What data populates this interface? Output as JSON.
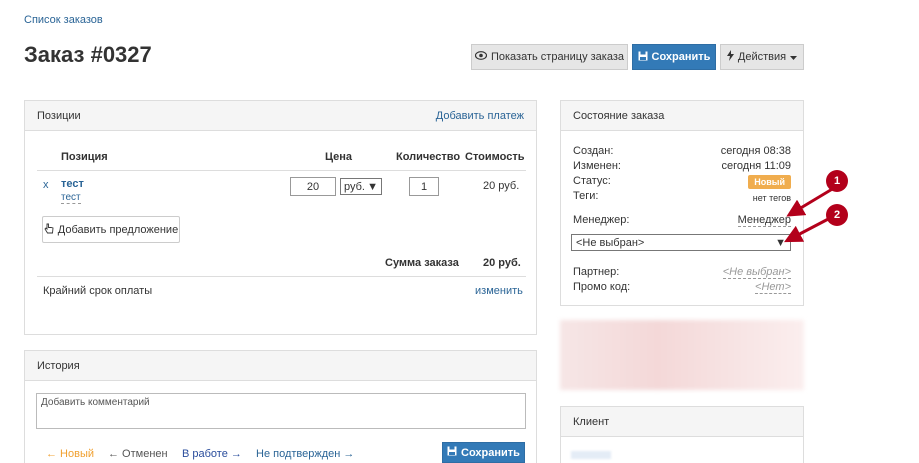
{
  "breadcrumb": {
    "label": "Список заказов"
  },
  "page": {
    "title": "Заказ #0327"
  },
  "toolbar": {
    "show_page_label": "Показать страницу заказа",
    "save_label": "Сохранить",
    "actions_label": "Действия"
  },
  "positions_panel": {
    "title": "Позиции",
    "add_payment": "Добавить платеж",
    "columns": {
      "position": "Позиция",
      "price": "Цена",
      "quantity": "Количество",
      "cost": "Стоимость"
    },
    "rows": [
      {
        "remove": "x",
        "name": "тест",
        "sub": "тест",
        "price": "20",
        "currency": "руб.",
        "quantity": "1",
        "cost": "20 руб."
      }
    ],
    "add_offer": "Добавить предложение",
    "total_label": "Сумма заказа",
    "total_value": "20 руб.",
    "deadline_label": "Крайний срок оплаты",
    "deadline_edit": "изменить"
  },
  "history_panel": {
    "title": "История",
    "comment_placeholder": "Добавить комментарий",
    "statuses": {
      "new": "← Новый",
      "cancelled": "← Отменен",
      "in_progress": "В работе →",
      "unconfirmed": "Не подтвержден →"
    },
    "save_label": "Сохранить"
  },
  "state_panel": {
    "title": "Состояние заказа",
    "created_label": "Создан:",
    "created_value": "сегодня 08:38",
    "changed_label": "Изменен:",
    "changed_value": "сегодня 11:09",
    "status_label": "Статус:",
    "status_value": "Новый",
    "tags_label": "Теги:",
    "tags_value": "нет тегов",
    "manager_label": "Менеджер:",
    "manager_value": "Менеджер",
    "manager_select": "<Не выбран>",
    "partner_label": "Партнер:",
    "partner_value": "<Не выбран>",
    "promo_label": "Промо код:",
    "promo_value": "<Нет>"
  },
  "client_panel": {
    "title": "Клиент"
  },
  "annotations": {
    "marker1": "1",
    "marker2": "2"
  },
  "colors": {
    "primary": "#337ab7",
    "badge": "#f0ad4e",
    "new_status": "#f0a030",
    "marker": "#b3001b"
  }
}
